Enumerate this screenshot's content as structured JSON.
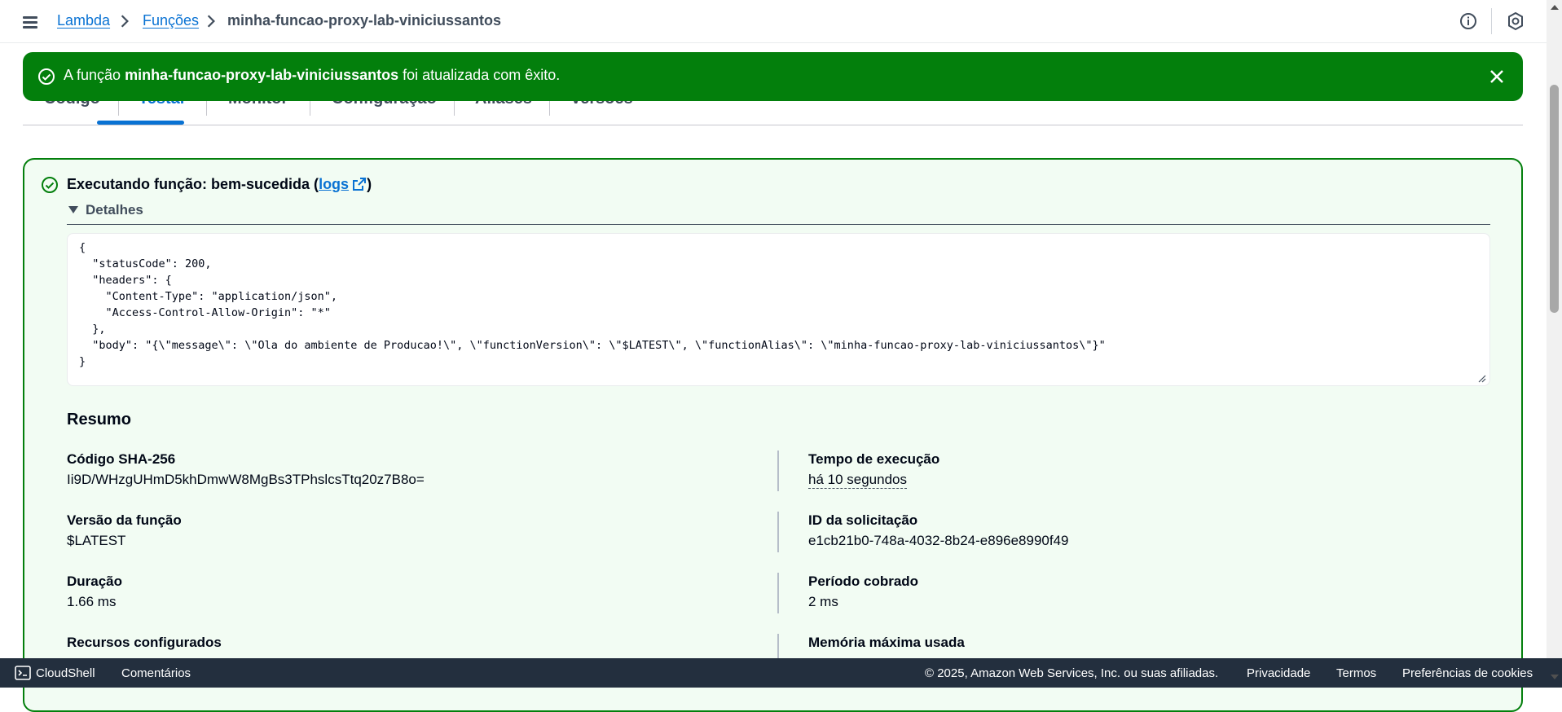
{
  "breadcrumb": {
    "items": [
      "Lambda",
      "Funções"
    ],
    "current": "minha-funcao-proxy-lab-viniciussantos"
  },
  "tabs": [
    "Código",
    "Testar",
    "Monitor",
    "Configuração",
    "Aliases",
    "Versões"
  ],
  "active_tab": "Testar",
  "flash": {
    "prefix": "A função ",
    "function_name": "minha-funcao-proxy-lab-viniciussantos",
    "suffix": " foi atualizada com êxito.",
    "color": "#037f0c"
  },
  "result": {
    "title_prefix": "Executando função: bem-sucedida (",
    "logs_link": "logs",
    "title_suffix": ")",
    "details_label": "Detalhes",
    "response_body": "{\n  \"statusCode\": 200,\n  \"headers\": {\n    \"Content-Type\": \"application/json\",\n    \"Access-Control-Allow-Origin\": \"*\"\n  },\n  \"body\": \"{\\\"message\\\": \\\"Ola do ambiente de Producao!\\\", \\\"functionVersion\\\": \\\"$LATEST\\\", \\\"functionAlias\\\": \\\"minha-funcao-proxy-lab-viniciussantos\\\"}\"\n}"
  },
  "summary": {
    "title": "Resumo",
    "left": [
      {
        "label": "Código SHA-256",
        "value": "Ii9D/WHzgUHmD5khDmwW8MgBs3TPhslcsTtq20z7B8o="
      },
      {
        "label": "Versão da função",
        "value": "$LATEST"
      },
      {
        "label": "Duração",
        "value": "1.66 ms"
      },
      {
        "label": "Recursos configurados",
        "value": ""
      }
    ],
    "right": [
      {
        "label": "Tempo de execução",
        "value": "há 10 segundos"
      },
      {
        "label": "ID da solicitação",
        "value": "e1cb21b0-748a-4032-8b24-e896e8990f49"
      },
      {
        "label": "Período cobrado",
        "value": "2 ms"
      },
      {
        "label": "Memória máxima usada",
        "value": ""
      }
    ]
  },
  "footer": {
    "cloudshell": "CloudShell",
    "feedback": "Comentários",
    "copyright": "© 2025, Amazon Web Services, Inc. ou suas afiliadas.",
    "privacy": "Privacidade",
    "terms": "Termos",
    "cookies": "Preferências de cookies"
  }
}
